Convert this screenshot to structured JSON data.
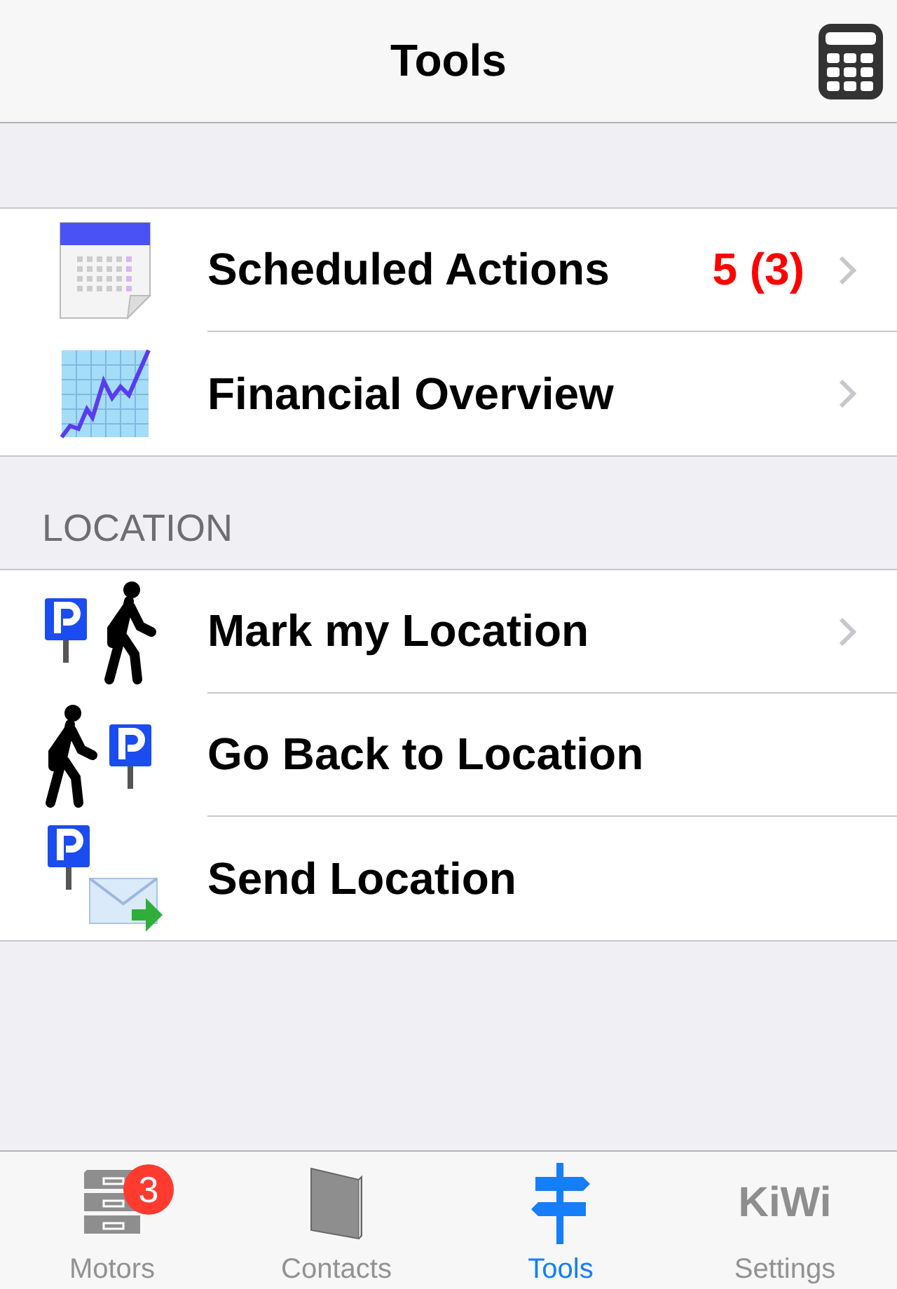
{
  "nav": {
    "title": "Tools"
  },
  "sections": [
    {
      "rows": [
        {
          "kind": "calendar",
          "label": "Scheduled Actions",
          "detail": "5 (3)",
          "disclosure": true
        },
        {
          "kind": "chart",
          "label": "Financial Overview",
          "disclosure": true
        }
      ]
    },
    {
      "header": "LOCATION",
      "rows": [
        {
          "kind": "park-walk",
          "label": "Mark my Location",
          "disclosure": true
        },
        {
          "kind": "walk-park",
          "label": "Go Back to Location",
          "disclosure": false
        },
        {
          "kind": "park-mail",
          "label": "Send Location",
          "disclosure": false
        }
      ]
    }
  ],
  "tabs": [
    {
      "kind": "drawers",
      "label": "Motors",
      "badge": "3",
      "selected": false
    },
    {
      "kind": "book",
      "label": "Contacts",
      "selected": false
    },
    {
      "kind": "signpost",
      "label": "Tools",
      "selected": true
    },
    {
      "kind": "text",
      "icon_text": "KiWi",
      "label": "Settings",
      "selected": false
    }
  ]
}
